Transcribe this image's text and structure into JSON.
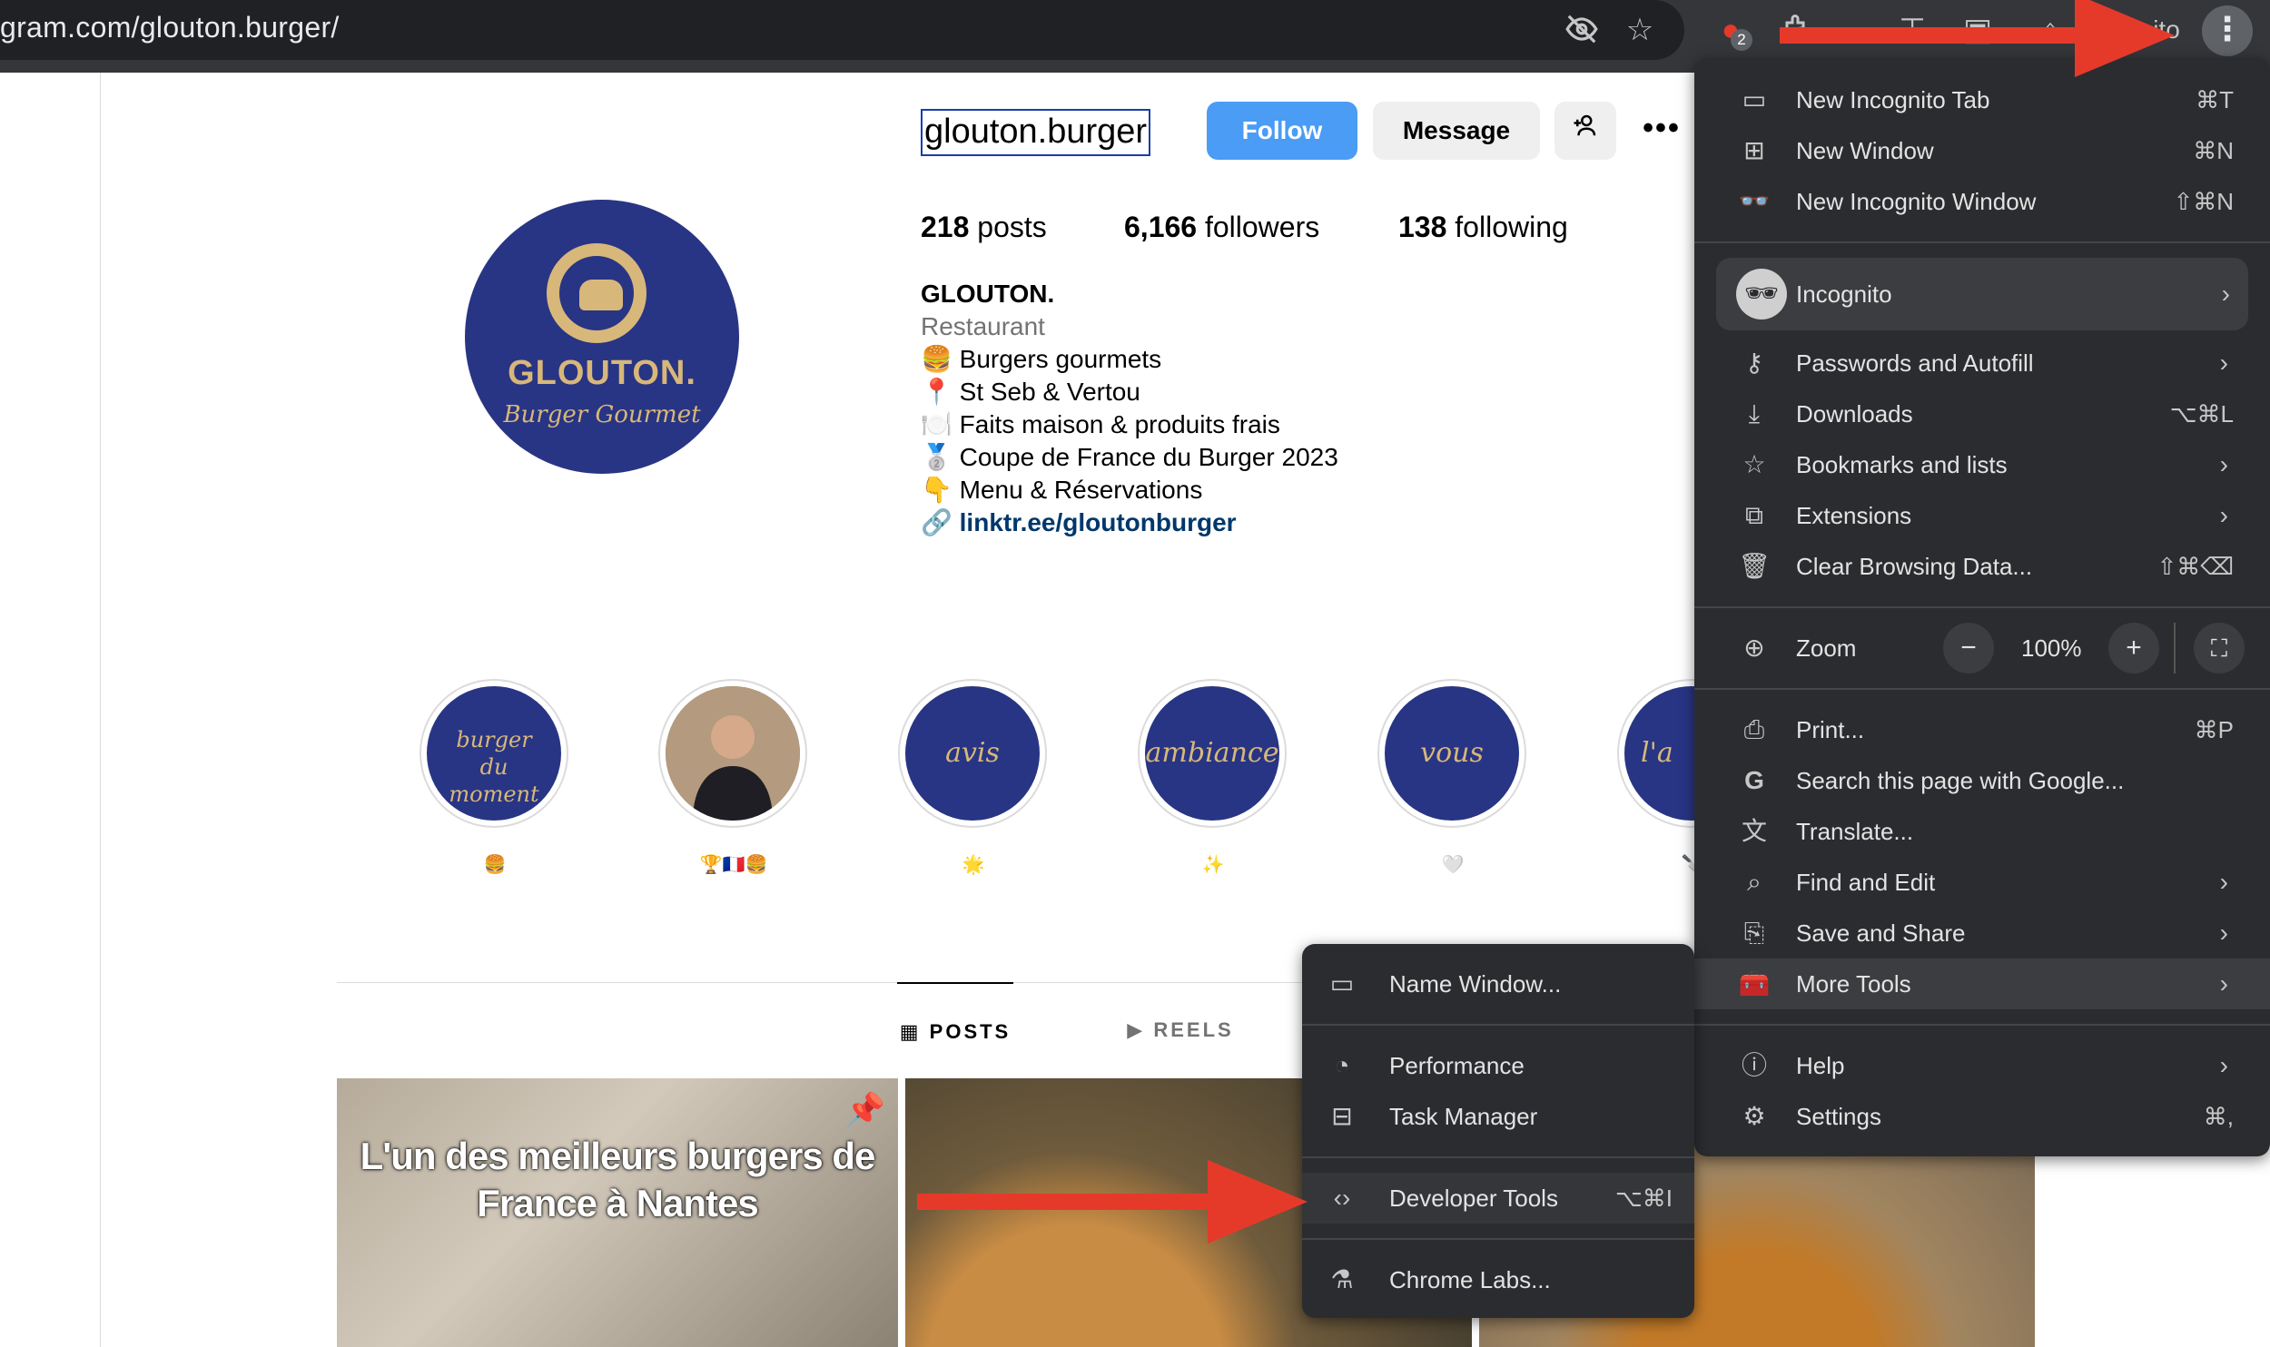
{
  "browser": {
    "url": "gram.com/glouton.burger/",
    "extensions_badge": "2",
    "profile_label": "ito",
    "menu_button_label": "⋮"
  },
  "profile": {
    "username": "glouton.burger",
    "follow_label": "Follow",
    "message_label": "Message",
    "stats": {
      "posts": {
        "count": "218",
        "label": "posts"
      },
      "followers": {
        "count": "6,166",
        "label": "followers"
      },
      "following": {
        "count": "138",
        "label": "following"
      }
    },
    "avatar": {
      "brand": "GLOUTON.",
      "tagline": "Burger Gourmet"
    },
    "bio": {
      "name": "GLOUTON.",
      "category": "Restaurant",
      "lines": [
        "🍔 Burgers gourmets",
        "📍 St Seb & Vertou",
        "🍽️ Faits maison & produits frais",
        "🥈 Coupe de France du Burger 2023",
        "👇 Menu & Réservations"
      ],
      "link": "linktr.ee/gloutonburger"
    }
  },
  "highlights": [
    {
      "title": "burger du moment",
      "caption": "🍔"
    },
    {
      "title": "",
      "caption": "🏆🇫🇷🍔"
    },
    {
      "title": "avis",
      "caption": "🌟"
    },
    {
      "title": "ambiance",
      "caption": "✨"
    },
    {
      "title": "vous",
      "caption": "🤍"
    },
    {
      "title": "l'a",
      "caption": "🔪"
    }
  ],
  "tabs": {
    "posts": "POSTS",
    "reels": "REELS"
  },
  "posts": [
    {
      "caption": "L'un des meilleurs burgers de France à Nantes"
    }
  ],
  "chrome_menu": {
    "items_top": [
      {
        "icon": "new-tab-icon",
        "label": "New Incognito Tab",
        "shortcut": "⌘T"
      },
      {
        "icon": "new-window-icon",
        "label": "New Window",
        "shortcut": "⌘N"
      },
      {
        "icon": "incognito-icon",
        "label": "New Incognito Window",
        "shortcut": "⇧⌘N"
      }
    ],
    "profile": {
      "label": "Incognito"
    },
    "items_mid": [
      {
        "icon": "key-icon",
        "label": "Passwords and Autofill",
        "shortcut": ""
      },
      {
        "icon": "download-icon",
        "label": "Downloads",
        "shortcut": "⌥⌘L"
      },
      {
        "icon": "star-icon",
        "label": "Bookmarks and lists",
        "shortcut": ""
      },
      {
        "icon": "puzzle-icon",
        "label": "Extensions",
        "shortcut": ""
      },
      {
        "icon": "trash-icon",
        "label": "Clear Browsing Data...",
        "shortcut": "⇧⌘⌫"
      }
    ],
    "zoom": {
      "label": "Zoom",
      "value": "100%",
      "minus": "−",
      "plus": "+"
    },
    "items_tools": [
      {
        "icon": "print-icon",
        "label": "Print...",
        "shortcut": "⌘P"
      },
      {
        "icon": "google-icon",
        "label": "Search this page with Google...",
        "shortcut": ""
      },
      {
        "icon": "translate-icon",
        "label": "Translate...",
        "shortcut": ""
      },
      {
        "icon": "find-icon",
        "label": "Find and Edit",
        "shortcut": ""
      },
      {
        "icon": "save-icon",
        "label": "Save and Share",
        "shortcut": ""
      },
      {
        "icon": "toolbox-icon",
        "label": "More Tools",
        "shortcut": ""
      }
    ],
    "items_bottom": [
      {
        "icon": "help-icon",
        "label": "Help",
        "shortcut": ""
      },
      {
        "icon": "gear-icon",
        "label": "Settings",
        "shortcut": "⌘,"
      }
    ]
  },
  "more_tools_menu": {
    "items": [
      {
        "icon": "window-icon",
        "label": "Name Window...",
        "shortcut": ""
      },
      {
        "icon": "performance-icon",
        "label": "Performance",
        "shortcut": ""
      },
      {
        "icon": "task-manager-icon",
        "label": "Task Manager",
        "shortcut": ""
      },
      {
        "icon": "code-icon",
        "label": "Developer Tools",
        "shortcut": "⌥⌘I"
      },
      {
        "icon": "flask-icon",
        "label": "Chrome Labs...",
        "shortcut": ""
      }
    ]
  },
  "colors": {
    "annotation_arrow": "#e53a2a",
    "follow": "#4a9cf5",
    "brand_navy": "#283584",
    "brand_gold": "#d8b77a",
    "menu_bg": "#2b2c2f"
  }
}
